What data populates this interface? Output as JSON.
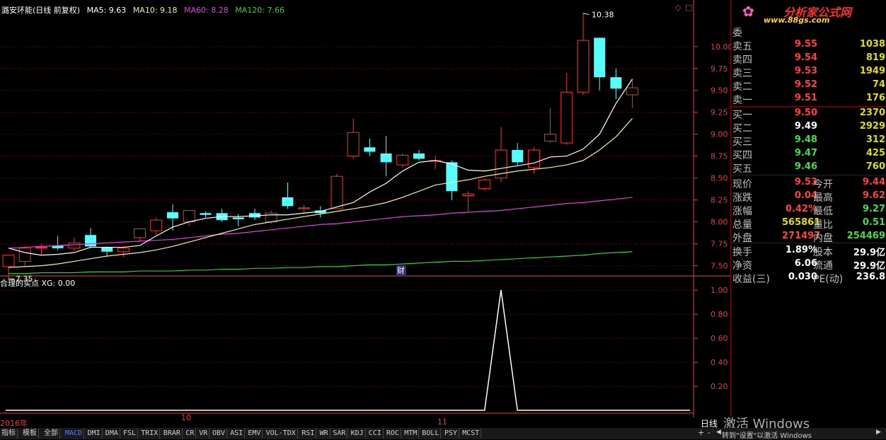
{
  "header": {
    "stock": "潞安环能(日线 前复权)",
    "ma5": "MA5: 9.63",
    "ma10": "MA10: 9.18",
    "ma60": "MA60: 8.28",
    "ma120": "MA120: 7.66"
  },
  "colors": {
    "up": "#ff3030",
    "down": "#54ffff",
    "ma5": "#ffffff",
    "ma10": "#f0f0a0",
    "ma60": "#e040e0",
    "ma120": "#30d030",
    "axis": "#e04040",
    "grid": "#600000"
  },
  "chart_data": {
    "type": "candlestick",
    "ylim": [
      7.4,
      10.45
    ],
    "yticks": [
      "10.00",
      "9.75",
      "9.50",
      "9.25",
      "9.00",
      "8.75",
      "8.50",
      "8.25",
      "8.00",
      "7.75",
      "7.50"
    ],
    "high_label": "10.38",
    "low_label": "7.35",
    "fin_marker": "财",
    "x_labels": [
      "2016年",
      "10",
      "11"
    ],
    "candles": [
      {
        "o": 7.49,
        "h": 7.53,
        "l": 7.35,
        "c": 7.62
      },
      {
        "o": 7.55,
        "h": 7.72,
        "l": 7.5,
        "c": 7.7
      },
      {
        "o": 7.71,
        "h": 7.75,
        "l": 7.62,
        "c": 7.71
      },
      {
        "o": 7.73,
        "h": 7.84,
        "l": 7.68,
        "c": 7.7
      },
      {
        "o": 7.7,
        "h": 7.82,
        "l": 7.67,
        "c": 7.76
      },
      {
        "o": 7.85,
        "h": 7.93,
        "l": 7.7,
        "c": 7.72
      },
      {
        "o": 7.71,
        "h": 7.72,
        "l": 7.6,
        "c": 7.66
      },
      {
        "o": 7.66,
        "h": 7.72,
        "l": 7.6,
        "c": 7.7
      },
      {
        "o": 7.82,
        "h": 7.9,
        "l": 7.78,
        "c": 7.92
      },
      {
        "o": 7.9,
        "h": 8.05,
        "l": 7.85,
        "c": 8.02
      },
      {
        "o": 8.11,
        "h": 8.2,
        "l": 7.9,
        "c": 8.04
      },
      {
        "o": 8.0,
        "h": 8.13,
        "l": 7.95,
        "c": 8.13
      },
      {
        "o": 8.1,
        "h": 8.12,
        "l": 8.05,
        "c": 8.08
      },
      {
        "o": 8.1,
        "h": 8.15,
        "l": 8.0,
        "c": 8.02
      },
      {
        "o": 8.05,
        "h": 8.09,
        "l": 7.95,
        "c": 8.03
      },
      {
        "o": 8.1,
        "h": 8.15,
        "l": 8.02,
        "c": 8.05
      },
      {
        "o": 8.0,
        "h": 8.13,
        "l": 7.98,
        "c": 8.1
      },
      {
        "o": 8.28,
        "h": 8.45,
        "l": 8.15,
        "c": 8.18
      },
      {
        "o": 8.15,
        "h": 8.2,
        "l": 8.1,
        "c": 8.16
      },
      {
        "o": 8.13,
        "h": 8.18,
        "l": 8.05,
        "c": 8.1
      },
      {
        "o": 8.15,
        "h": 8.55,
        "l": 8.15,
        "c": 8.52
      },
      {
        "o": 8.75,
        "h": 9.18,
        "l": 8.72,
        "c": 9.02
      },
      {
        "o": 8.85,
        "h": 8.95,
        "l": 8.75,
        "c": 8.8
      },
      {
        "o": 8.78,
        "h": 8.98,
        "l": 8.52,
        "c": 8.68
      },
      {
        "o": 8.65,
        "h": 8.78,
        "l": 8.62,
        "c": 8.76
      },
      {
        "o": 8.78,
        "h": 8.82,
        "l": 8.7,
        "c": 8.72
      },
      {
        "o": 8.7,
        "h": 8.76,
        "l": 8.6,
        "c": 8.7
      },
      {
        "o": 8.68,
        "h": 8.7,
        "l": 8.25,
        "c": 8.35
      },
      {
        "o": 8.3,
        "h": 8.35,
        "l": 8.12,
        "c": 8.32
      },
      {
        "o": 8.38,
        "h": 8.5,
        "l": 8.36,
        "c": 8.48
      },
      {
        "o": 8.5,
        "h": 9.08,
        "l": 8.45,
        "c": 8.82
      },
      {
        "o": 8.82,
        "h": 8.9,
        "l": 8.65,
        "c": 8.68
      },
      {
        "o": 8.62,
        "h": 8.85,
        "l": 8.55,
        "c": 8.82
      },
      {
        "o": 8.92,
        "h": 9.3,
        "l": 8.9,
        "c": 9.0
      },
      {
        "o": 8.9,
        "h": 9.7,
        "l": 8.88,
        "c": 9.48
      },
      {
        "o": 9.48,
        "h": 10.38,
        "l": 9.45,
        "c": 10.07
      },
      {
        "o": 10.1,
        "h": 10.1,
        "l": 9.5,
        "c": 9.65
      },
      {
        "o": 9.65,
        "h": 9.75,
        "l": 9.4,
        "c": 9.52
      },
      {
        "o": 9.45,
        "h": 9.62,
        "l": 9.3,
        "c": 9.53
      }
    ],
    "ma5": [
      7.7,
      7.65,
      7.62,
      7.63,
      7.65,
      7.71,
      7.71,
      7.71,
      7.73,
      7.84,
      7.94,
      8.0,
      8.04,
      8.06,
      8.06,
      8.07,
      8.08,
      8.08,
      8.1,
      8.12,
      8.17,
      8.22,
      8.34,
      8.44,
      8.58,
      8.68,
      8.7,
      8.66,
      8.59,
      8.58,
      8.61,
      8.64,
      8.67,
      8.74,
      8.75,
      8.83,
      9.0,
      9.35,
      9.63
    ],
    "ma10": [
      7.48,
      7.49,
      7.5,
      7.52,
      7.55,
      7.58,
      7.61,
      7.63,
      7.65,
      7.68,
      7.72,
      7.77,
      7.82,
      7.87,
      7.92,
      7.97,
      8.0,
      8.03,
      8.06,
      8.09,
      8.12,
      8.15,
      8.18,
      8.22,
      8.28,
      8.35,
      8.42,
      8.45,
      8.48,
      8.52,
      8.55,
      8.58,
      8.6,
      8.62,
      8.65,
      8.7,
      8.82,
      8.97,
      9.18
    ],
    "ma60": [
      7.7,
      7.71,
      7.72,
      7.73,
      7.74,
      7.75,
      7.76,
      7.77,
      7.78,
      7.79,
      7.8,
      7.82,
      7.84,
      7.86,
      7.87,
      7.89,
      7.91,
      7.93,
      7.95,
      7.97,
      7.98,
      8.0,
      8.02,
      8.04,
      8.06,
      8.07,
      8.08,
      8.1,
      8.11,
      8.12,
      8.13,
      8.15,
      8.17,
      8.19,
      8.21,
      8.22,
      8.24,
      8.26,
      8.28
    ],
    "ma120": [
      7.41,
      7.41,
      7.42,
      7.42,
      7.42,
      7.43,
      7.43,
      7.43,
      7.44,
      7.44,
      7.44,
      7.45,
      7.45,
      7.46,
      7.46,
      7.47,
      7.47,
      7.48,
      7.48,
      7.49,
      7.49,
      7.5,
      7.51,
      7.51,
      7.52,
      7.53,
      7.54,
      7.55,
      7.55,
      7.56,
      7.57,
      7.58,
      7.59,
      7.6,
      7.61,
      7.62,
      7.64,
      7.65,
      7.66
    ]
  },
  "sub_chart": {
    "title": "合理的买点 XG: 0.00",
    "yticks": [
      "1.00",
      "0.80",
      "0.60",
      "0.40",
      "0.20"
    ],
    "signal": [
      0,
      0,
      0,
      0,
      0,
      0,
      0,
      0,
      0,
      0,
      0,
      0,
      0,
      0,
      0,
      0,
      0,
      0,
      0,
      0,
      0,
      0,
      0,
      0,
      0,
      0,
      0,
      0,
      0,
      0,
      1,
      0,
      0,
      0,
      0,
      0,
      0,
      0,
      0
    ]
  },
  "order_book": {
    "wei_label": "委",
    "sells": [
      {
        "label": "卖五",
        "price": "9.55",
        "vol": "1038"
      },
      {
        "label": "卖四",
        "price": "9.54",
        "vol": "819"
      },
      {
        "label": "卖三",
        "price": "9.53",
        "vol": "1949"
      },
      {
        "label": "卖二",
        "price": "9.52",
        "vol": "74"
      },
      {
        "label": "卖一",
        "price": "9.51",
        "vol": "176"
      }
    ],
    "buys": [
      {
        "label": "买一",
        "price": "9.50",
        "vol": "2370"
      },
      {
        "label": "买二",
        "price": "9.49",
        "vol": "2929"
      },
      {
        "label": "买三",
        "price": "9.48",
        "vol": "312"
      },
      {
        "label": "买四",
        "price": "9.47",
        "vol": "425"
      },
      {
        "label": "买五",
        "price": "9.46",
        "vol": "760"
      }
    ]
  },
  "quotes": [
    {
      "l1": "现价",
      "v1": "9.53",
      "l2": "今开",
      "v2": "9.44"
    },
    {
      "l1": "涨跌",
      "v1": "0.04",
      "l2": "最高",
      "v2": "9.62"
    },
    {
      "l1": "涨幅",
      "v1": "0.42%",
      "l2": "最低",
      "v2": "9.27"
    },
    {
      "l1": "总量",
      "v1": "565861",
      "l2": "量比",
      "v2": "0.51"
    },
    {
      "l1": "外盘",
      "v1": "271497",
      "l2": "内盘",
      "v2": "254469"
    }
  ],
  "fundamentals": [
    {
      "l1": "换手",
      "v1": "1.89%",
      "l2": "股本",
      "v2": "29.9亿"
    },
    {
      "l1": "净资",
      "v1": "6.06",
      "l2": "流通",
      "v2": "29.9亿"
    },
    {
      "l1": "收益(三)",
      "v1": "0.030",
      "l2": "PE(动)",
      "v2": "236.8"
    }
  ],
  "logo": {
    "name": "分析家公式网",
    "url": "www.88gs.com"
  },
  "bottom_tabs": [
    "指标",
    "模板",
    "全部",
    "MACD",
    "DMI",
    "DMA",
    "FSL",
    "TRIX",
    "BRAR",
    "CR",
    "VR",
    "OBV",
    "ASI",
    "EMV",
    "VOL-TDX",
    "RSI",
    "WR",
    "SAR",
    "KDJ",
    "CCI",
    "ROC",
    "MTM",
    "BOLL",
    "PSY",
    "MCST"
  ],
  "period_label": "日线",
  "win_watermark": "激活 Windows",
  "win_watermark_sub": "转到\"设置\"以激活 Windows"
}
